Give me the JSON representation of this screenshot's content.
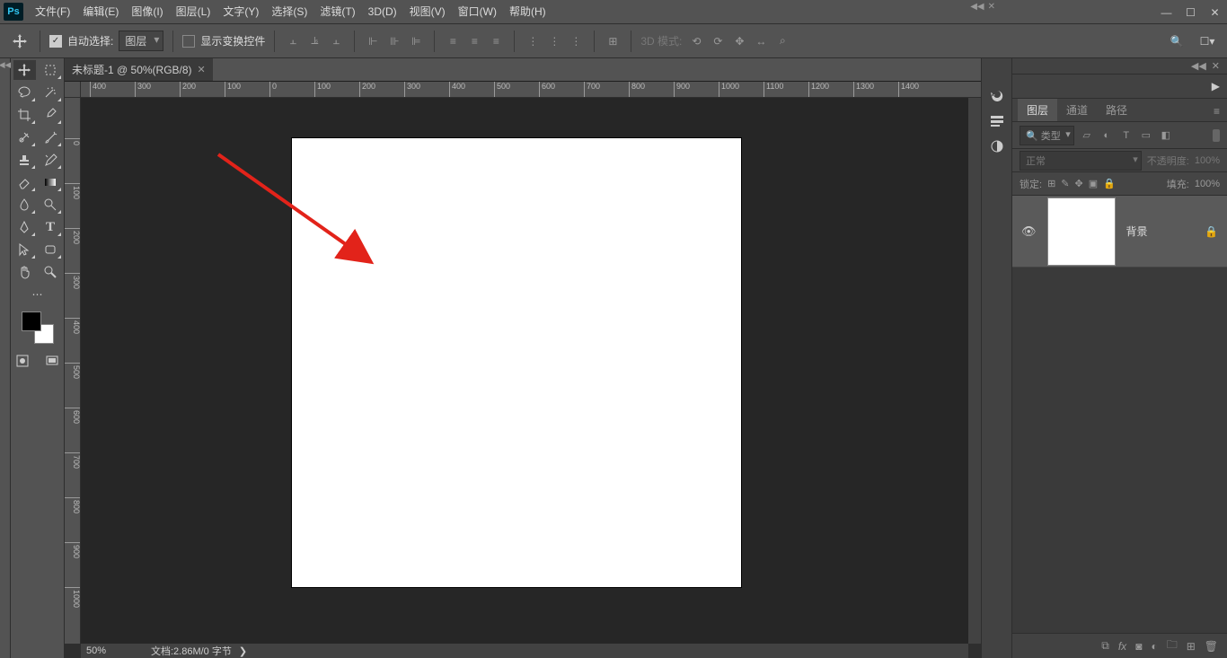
{
  "app": {
    "logo": "Ps"
  },
  "menu": {
    "file": "文件(F)",
    "edit": "编辑(E)",
    "image": "图像(I)",
    "layer": "图层(L)",
    "type": "文字(Y)",
    "select": "选择(S)",
    "filter": "滤镜(T)",
    "threed": "3D(D)",
    "view": "视图(V)",
    "window": "窗口(W)",
    "help": "帮助(H)"
  },
  "opt": {
    "autoselect": "自动选择:",
    "dropdown": "图层",
    "transform": "显示变换控件",
    "mode3d": "3D 模式:"
  },
  "doc": {
    "tab": "未标题-1 @ 50%(RGB/8)",
    "zoom": "50%",
    "info": "文档:2.86M/0 字节",
    "arrow": "❯"
  },
  "ruler_h": [
    "400",
    "300",
    "200",
    "100",
    "0",
    "100",
    "200",
    "300",
    "400",
    "500",
    "600",
    "700",
    "800",
    "900",
    "1000",
    "1100",
    "1200",
    "1300",
    "1400"
  ],
  "ruler_v": [
    "0",
    "100",
    "200",
    "300",
    "400",
    "500",
    "600",
    "700",
    "800",
    "900",
    "1000"
  ],
  "panel": {
    "tabs": {
      "layers": "图层",
      "channels": "通道",
      "paths": "路径"
    },
    "filter": "类型",
    "blend": "正常",
    "opacity_label": "不透明度:",
    "opacity_value": "100%",
    "lock_label": "锁定:",
    "fill_label": "填充:",
    "fill_value": "100%",
    "layer_name": "背景"
  }
}
